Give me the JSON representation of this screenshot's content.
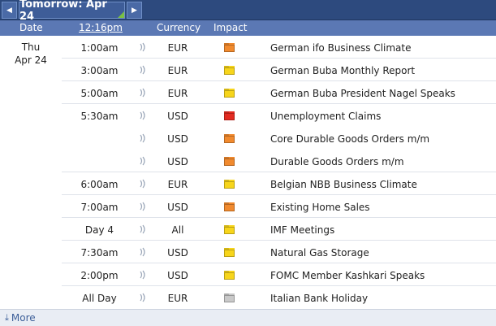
{
  "nav": {
    "prev_icon": "◀",
    "next_icon": "▶",
    "title": "Tomorrow: Apr 24"
  },
  "header": {
    "date": "Date",
    "time": "12:16pm",
    "currency": "Currency",
    "impact": "Impact"
  },
  "date": {
    "dow": "Thu",
    "day": "Apr 24"
  },
  "impact_colors": {
    "high": "#e32b21",
    "medium": "#f18a2e",
    "low": "#f7d51b",
    "holiday": "#c9c9c9"
  },
  "events": [
    {
      "time": "1:00am",
      "currency": "EUR",
      "impact": "medium",
      "event": "German ifo Business Climate"
    },
    {
      "time": "3:00am",
      "currency": "EUR",
      "impact": "low",
      "event": "German Buba Monthly Report"
    },
    {
      "time": "5:00am",
      "currency": "EUR",
      "impact": "low",
      "event": "German Buba President Nagel Speaks"
    },
    {
      "time": "5:30am",
      "currency": "USD",
      "impact": "high",
      "event": "Unemployment Claims"
    },
    {
      "time": "",
      "currency": "USD",
      "impact": "medium",
      "event": "Core Durable Goods Orders m/m"
    },
    {
      "time": "",
      "currency": "USD",
      "impact": "medium",
      "event": "Durable Goods Orders m/m"
    },
    {
      "time": "6:00am",
      "currency": "EUR",
      "impact": "low",
      "event": "Belgian NBB Business Climate"
    },
    {
      "time": "7:00am",
      "currency": "USD",
      "impact": "medium",
      "event": "Existing Home Sales"
    },
    {
      "time": "Day 4",
      "currency": "All",
      "impact": "low",
      "event": "IMF Meetings"
    },
    {
      "time": "7:30am",
      "currency": "USD",
      "impact": "low",
      "event": "Natural Gas Storage"
    },
    {
      "time": "2:00pm",
      "currency": "USD",
      "impact": "low",
      "event": "FOMC Member Kashkari Speaks"
    },
    {
      "time": "All Day",
      "currency": "EUR",
      "impact": "holiday",
      "event": "Italian Bank Holiday"
    }
  ],
  "footer": {
    "more_icon": "⤓",
    "more_label": "More"
  }
}
